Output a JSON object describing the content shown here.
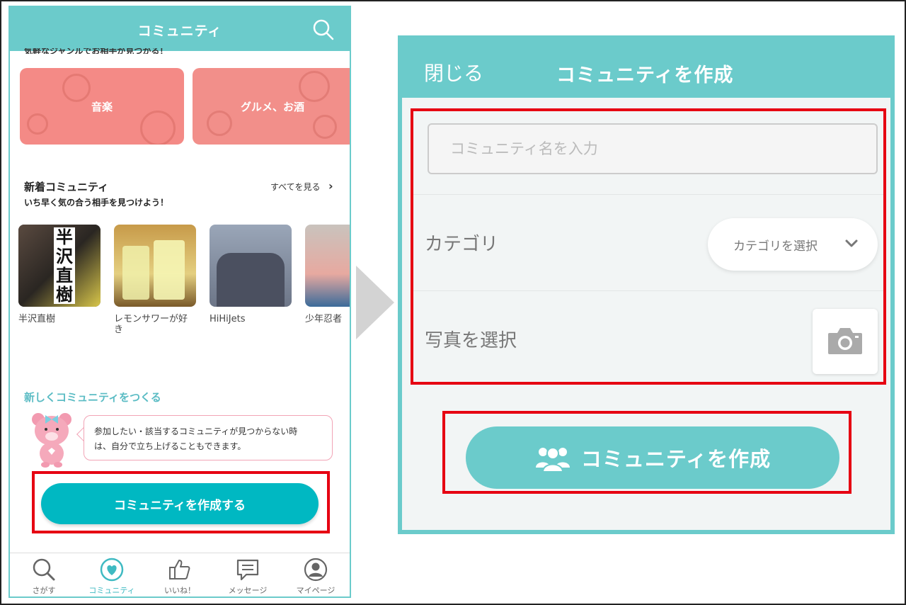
{
  "left_screen": {
    "header": {
      "title": "コミュニティ",
      "search_icon": "search-icon"
    },
    "cut_off_text": "気軽なジャンルでお相手が見つかる！",
    "categories": [
      {
        "label": "音楽"
      },
      {
        "label": "グルメ、お酒"
      }
    ],
    "new_communities": {
      "title": "新着コミュニティ",
      "subtitle": "いち早く気の合う相手を見つけよう！",
      "see_all": "すべてを見る",
      "items": [
        {
          "label": "半沢直樹",
          "poster_text": "半沢直樹"
        },
        {
          "label": "レモンサワーが好き"
        },
        {
          "label": "HiHiJets"
        },
        {
          "label": "少年忍者"
        }
      ]
    },
    "create_section": {
      "heading": "新しくコミュニティをつくる",
      "bubble_line1": "参加したい・該当するコミュニティが見つからない時",
      "bubble_line2": "は、自分で立ち上げることもできます。",
      "button": "コミュニティを作成する"
    },
    "tabbar": [
      {
        "label": "さがす",
        "icon": "search-icon"
      },
      {
        "label": "コミュニティ",
        "icon": "heart-icon",
        "active": true
      },
      {
        "label": "いいね！",
        "icon": "thumbs-up-icon"
      },
      {
        "label": "メッセージ",
        "icon": "message-icon"
      },
      {
        "label": "マイページ",
        "icon": "user-icon"
      }
    ]
  },
  "right_screen": {
    "header": {
      "close": "閉じる",
      "title": "コミュニティを作成"
    },
    "name_input": {
      "placeholder": "コミュニティ名を入力",
      "value": ""
    },
    "category": {
      "label": "カテゴリ",
      "select_text": "カテゴリを選択"
    },
    "photo": {
      "label": "写真を選択",
      "icon": "camera-icon"
    },
    "create_button": "コミュニティを作成"
  },
  "colors": {
    "teal": "#6bcbcb",
    "button_teal": "#00b8c2",
    "highlight_red": "#e60012",
    "card_pink": "#f48a86"
  }
}
